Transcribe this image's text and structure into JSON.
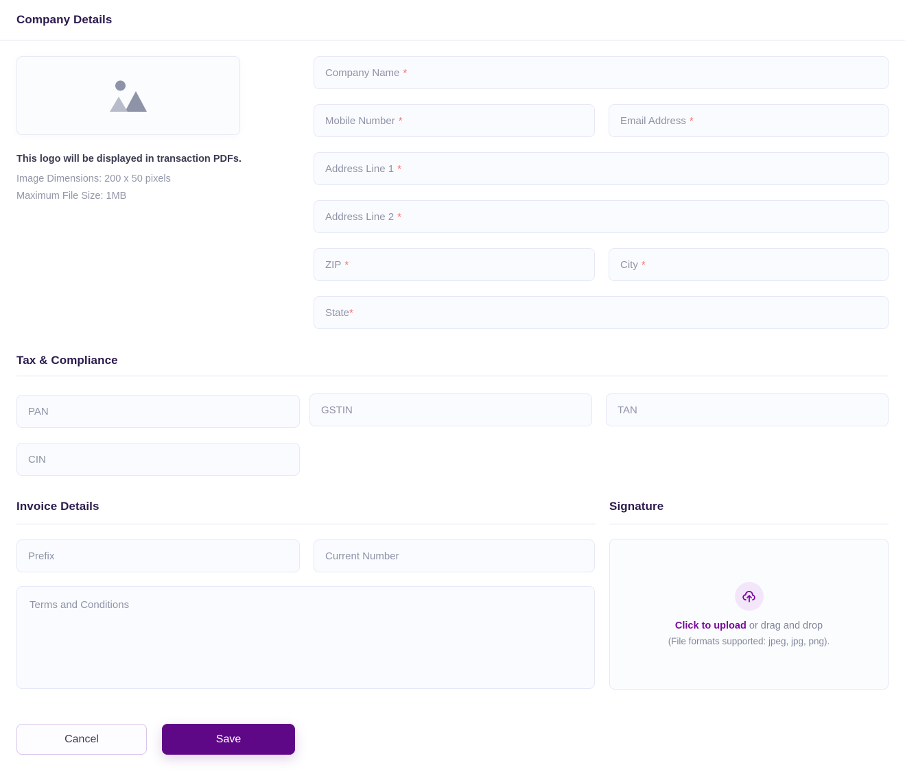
{
  "header": {
    "title": "Company Details"
  },
  "logo": {
    "placeholder_icon": "image-placeholder-icon",
    "note": "This logo will be displayed in transaction PDFs.",
    "dimensions": "Image Dimensions: 200 x 50 pixels",
    "max_size": "Maximum File Size: 1MB"
  },
  "company_fields": {
    "company_name": {
      "label": "Company Name",
      "required_mark": "*",
      "value": ""
    },
    "mobile_number": {
      "label": "Mobile Number",
      "required_mark": "*",
      "value": ""
    },
    "email_address": {
      "label": "Email Address",
      "required_mark": "*",
      "value": ""
    },
    "address_line_1": {
      "label": "Address Line 1",
      "required_mark": "*",
      "value": ""
    },
    "address_line_2": {
      "label": "Address Line 2",
      "required_mark": "*",
      "value": ""
    },
    "zip": {
      "label": "ZIP",
      "required_mark": "*",
      "value": ""
    },
    "city": {
      "label": "City",
      "required_mark": "*",
      "value": ""
    },
    "state": {
      "label": "State",
      "required_mark": "*",
      "value": ""
    }
  },
  "tax": {
    "title": "Tax & Compliance",
    "pan": {
      "label": "PAN",
      "value": ""
    },
    "gstin": {
      "label": "GSTIN",
      "value": ""
    },
    "tan": {
      "label": "TAN",
      "value": ""
    },
    "cin": {
      "label": "CIN",
      "value": ""
    }
  },
  "invoice": {
    "title": "Invoice Details",
    "prefix": {
      "label": "Prefix",
      "value": ""
    },
    "current_number": {
      "label": "Current Number",
      "value": ""
    },
    "terms": {
      "label": "Terms and Conditions",
      "value": ""
    }
  },
  "signature": {
    "title": "Signature",
    "upload_icon": "cloud-upload-icon",
    "cta_bold": "Click to upload",
    "cta_rest": " or drag and drop",
    "formats": "(File formats supported: jpeg, jpg, png)."
  },
  "footer": {
    "cancel_label": "Cancel",
    "save_label": "Save"
  },
  "colors": {
    "accent_purple": "#5f0887",
    "link_purple": "#79089b",
    "heading": "#2b1a4d",
    "required_red": "#f4746a",
    "field_border": "#e5e9f7",
    "field_bg": "#fafbff"
  }
}
